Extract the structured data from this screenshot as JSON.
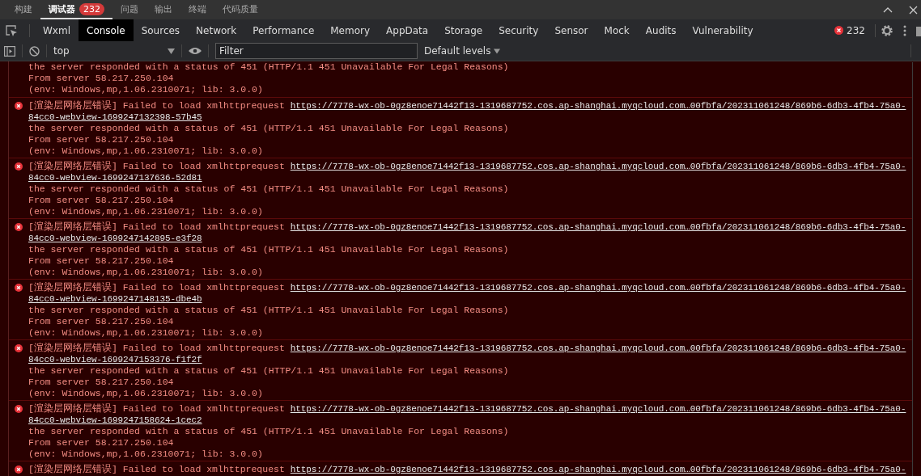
{
  "top_tabs": [
    {
      "label": "构建",
      "selected": false
    },
    {
      "label": "调试器",
      "selected": true,
      "badge": "232"
    },
    {
      "label": "问题",
      "selected": false
    },
    {
      "label": "输出",
      "selected": false
    },
    {
      "label": "终端",
      "selected": false
    },
    {
      "label": "代码质量",
      "selected": false
    }
  ],
  "devtools_tabs": [
    {
      "label": "Wxml",
      "selected": false
    },
    {
      "label": "Console",
      "selected": true
    },
    {
      "label": "Sources",
      "selected": false
    },
    {
      "label": "Network",
      "selected": false
    },
    {
      "label": "Performance",
      "selected": false
    },
    {
      "label": "Memory",
      "selected": false
    },
    {
      "label": "AppData",
      "selected": false
    },
    {
      "label": "Storage",
      "selected": false
    },
    {
      "label": "Security",
      "selected": false
    },
    {
      "label": "Sensor",
      "selected": false
    },
    {
      "label": "Mock",
      "selected": false
    },
    {
      "label": "Audits",
      "selected": false
    },
    {
      "label": "Vulnerability",
      "selected": false
    }
  ],
  "error_count": "232",
  "toolbar": {
    "context": "top",
    "filter_placeholder": "Filter",
    "levels": "Default levels"
  },
  "messages": [
    {
      "kind": "error",
      "lines": [
        "the server responded with a status of 451 (HTTP/1.1 451 Unavailable For Legal Reasons)",
        "From server 58.217.250.104",
        "(env: Windows,mp,1.06.2310071; lib: 3.0.0)"
      ]
    },
    {
      "kind": "error",
      "prefix": "[渲染层网络层错误] Failed to load xmlhttprequest",
      "url": "https://7778-wx-ob-0gz8enoe71442f13-1319687752.cos.ap-shanghai.myqcloud.com…00fbfa/202311061248/869b6-6db3-4fb4-75a0-",
      "url_tail": "84cc0-webview-1699247132398-57b45",
      "lines": [
        "the server responded with a status of 451 (HTTP/1.1 451 Unavailable For Legal Reasons)",
        "From server 58.217.250.104",
        "(env: Windows,mp,1.06.2310071; lib: 3.0.0)"
      ]
    },
    {
      "kind": "error",
      "prefix": "[渲染层网络层错误] Failed to load xmlhttprequest",
      "url": "https://7778-wx-ob-0gz8enoe71442f13-1319687752.cos.ap-shanghai.myqcloud.com…00fbfa/202311061248/869b6-6db3-4fb4-75a0-",
      "url_tail": "84cc0-webview-1699247137636-52d81",
      "lines": [
        "the server responded with a status of 451 (HTTP/1.1 451 Unavailable For Legal Reasons)",
        "From server 58.217.250.104",
        "(env: Windows,mp,1.06.2310071; lib: 3.0.0)"
      ]
    },
    {
      "kind": "error",
      "prefix": "[渲染层网络层错误] Failed to load xmlhttprequest",
      "url": "https://7778-wx-ob-0gz8enoe71442f13-1319687752.cos.ap-shanghai.myqcloud.com…00fbfa/202311061248/869b6-6db3-4fb4-75a0-",
      "url_tail": "84cc0-webview-1699247142895-e3f28",
      "lines": [
        "the server responded with a status of 451 (HTTP/1.1 451 Unavailable For Legal Reasons)",
        "From server 58.217.250.104",
        "(env: Windows,mp,1.06.2310071; lib: 3.0.0)"
      ]
    },
    {
      "kind": "error",
      "prefix": "[渲染层网络层错误] Failed to load xmlhttprequest",
      "url": "https://7778-wx-ob-0gz8enoe71442f13-1319687752.cos.ap-shanghai.myqcloud.com…00fbfa/202311061248/869b6-6db3-4fb4-75a0-",
      "url_tail": "84cc0-webview-1699247148135-dbe4b",
      "lines": [
        "the server responded with a status of 451 (HTTP/1.1 451 Unavailable For Legal Reasons)",
        "From server 58.217.250.104",
        "(env: Windows,mp,1.06.2310071; lib: 3.0.0)"
      ]
    },
    {
      "kind": "error",
      "prefix": "[渲染层网络层错误] Failed to load xmlhttprequest",
      "url": "https://7778-wx-ob-0gz8enoe71442f13-1319687752.cos.ap-shanghai.myqcloud.com…00fbfa/202311061248/869b6-6db3-4fb4-75a0-",
      "url_tail": "84cc0-webview-1699247153376-f1f2f",
      "lines": [
        "the server responded with a status of 451 (HTTP/1.1 451 Unavailable For Legal Reasons)",
        "From server 58.217.250.104",
        "(env: Windows,mp,1.06.2310071; lib: 3.0.0)"
      ]
    },
    {
      "kind": "error",
      "prefix": "[渲染层网络层错误] Failed to load xmlhttprequest",
      "url": "https://7778-wx-ob-0gz8enoe71442f13-1319687752.cos.ap-shanghai.myqcloud.com…00fbfa/202311061248/869b6-6db3-4fb4-75a0-",
      "url_tail": "84cc0-webview-1699247158624-1cec2",
      "lines": [
        "the server responded with a status of 451 (HTTP/1.1 451 Unavailable For Legal Reasons)",
        "From server 58.217.250.104",
        "(env: Windows,mp,1.06.2310071; lib: 3.0.0)"
      ]
    },
    {
      "kind": "error",
      "prefix": "[渲染层网络层错误] Failed to load xmlhttprequest",
      "url": "https://7778-wx-ob-0gz8enoe71442f13-1319687752.cos.ap-shanghai.myqcloud.com…00fbfa/202311061248/869b6-6db3-4fb4-75a0-"
    }
  ]
}
